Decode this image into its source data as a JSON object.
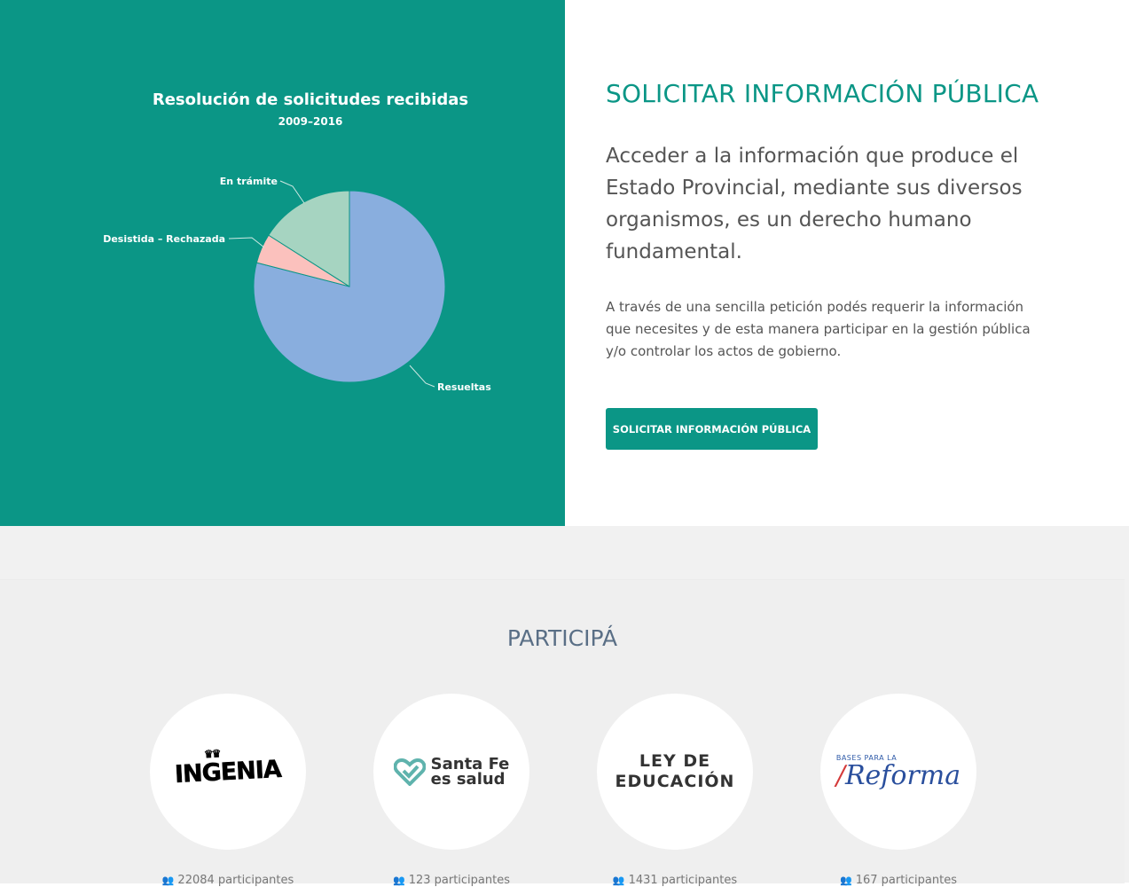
{
  "chart_panel": {
    "chart_data": {
      "type": "pie",
      "title": "Resolución de solicitudes recibidas",
      "subtitle": "2009–2016",
      "slices": [
        {
          "label": "Resueltas",
          "value": 79,
          "color": "#89aede"
        },
        {
          "label": "Desistida – Rechazada",
          "value": 5,
          "color": "#fbc1bd"
        },
        {
          "label": "En trámite",
          "value": 16,
          "color": "#a6d4c1"
        }
      ]
    }
  },
  "info": {
    "title": "SOLICITAR INFORMACIÓN PÚBLICA",
    "lead": "Acceder a la información que produce el Estado Provincial, mediante sus diversos organismos, es un derecho humano fundamental.",
    "body": "A través de una sencilla petición podés requerir la información que necesites y de esta manera participar en la gestión pública y/o controlar los actos de gobierno.",
    "button_label": "SOLICITAR INFORMACIÓN PÚBLICA"
  },
  "participa": {
    "title": "PARTICIPÁ",
    "cards": [
      {
        "logo_text": "INGENIA",
        "crown": "♛♛",
        "count": "22084 participantes",
        "icon": "people-icon"
      },
      {
        "logo_line1": "Santa Fe",
        "logo_line2": "es salud",
        "count": "123 participantes",
        "icon": "people-icon"
      },
      {
        "logo_line1": "LEY DE",
        "logo_line2": "EDUCACIÓN",
        "count": "1431 participantes",
        "icon": "people-icon"
      },
      {
        "logo_small": "BASES PARA LA",
        "logo_big": "Reforma",
        "count": "167 participantes",
        "icon": "people-icon"
      }
    ]
  },
  "colors": {
    "teal": "#0b9686",
    "section_bg": "#f1f1f1",
    "participa_title": "#5a6f86"
  }
}
